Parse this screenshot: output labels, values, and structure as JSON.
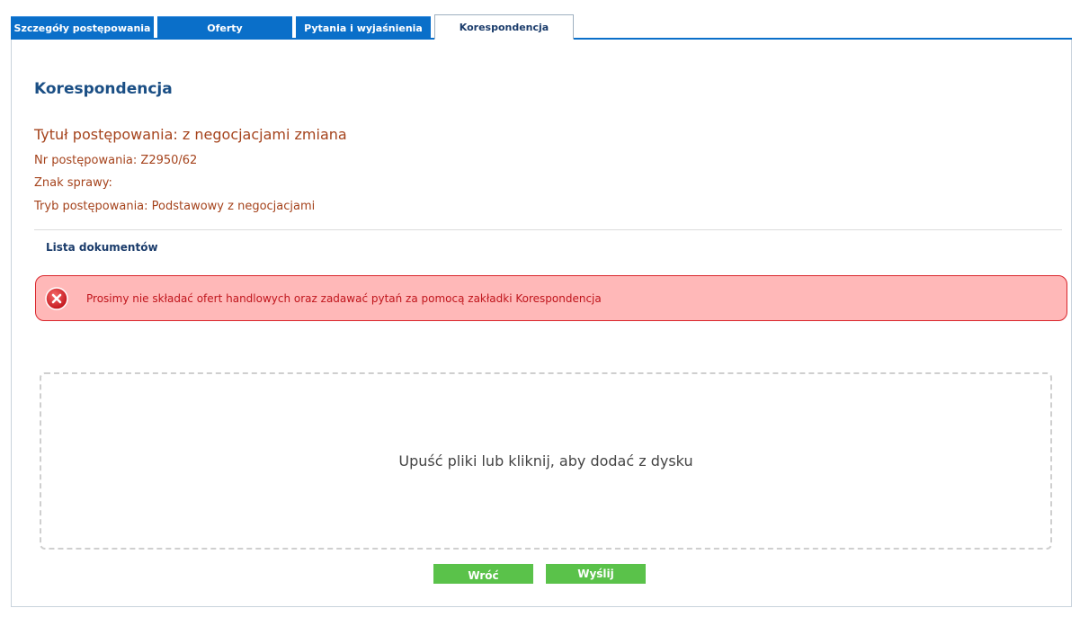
{
  "tabs": [
    {
      "label": "Szczegóły postępowania"
    },
    {
      "label": "Oferty"
    },
    {
      "label": "Pytania i wyjaśnienia"
    },
    {
      "label": "Korespondencja"
    }
  ],
  "page": {
    "title": "Korespondencja",
    "proceeding_title": "Tytuł postępowania: z negocjacjami zmiana",
    "proceeding_number": "Nr postępowania: Z2950/62",
    "case_mark": "Znak sprawy:",
    "proceeding_mode": "Tryb postępowania: Podstawowy z negocjacjami"
  },
  "documents": {
    "heading": "Lista dokumentów"
  },
  "alert": {
    "icon": "error-x-icon",
    "message": "Prosimy nie składać ofert handlowych oraz zadawać pytań za pomocą zakładki Korespondencja",
    "color": "#d9262c"
  },
  "dropzone": {
    "text": "Upuść pliki lub kliknij, aby dodać z dysku"
  },
  "buttons": {
    "back": "Wróć",
    "send": "Wyślij"
  },
  "colors": {
    "tab_active_bg": "#ffffff",
    "tab_bg": "#0a6fc9",
    "button_green": "#5ac24a",
    "heading_blue": "#1b4f85",
    "meta_brown": "#a5431c"
  }
}
